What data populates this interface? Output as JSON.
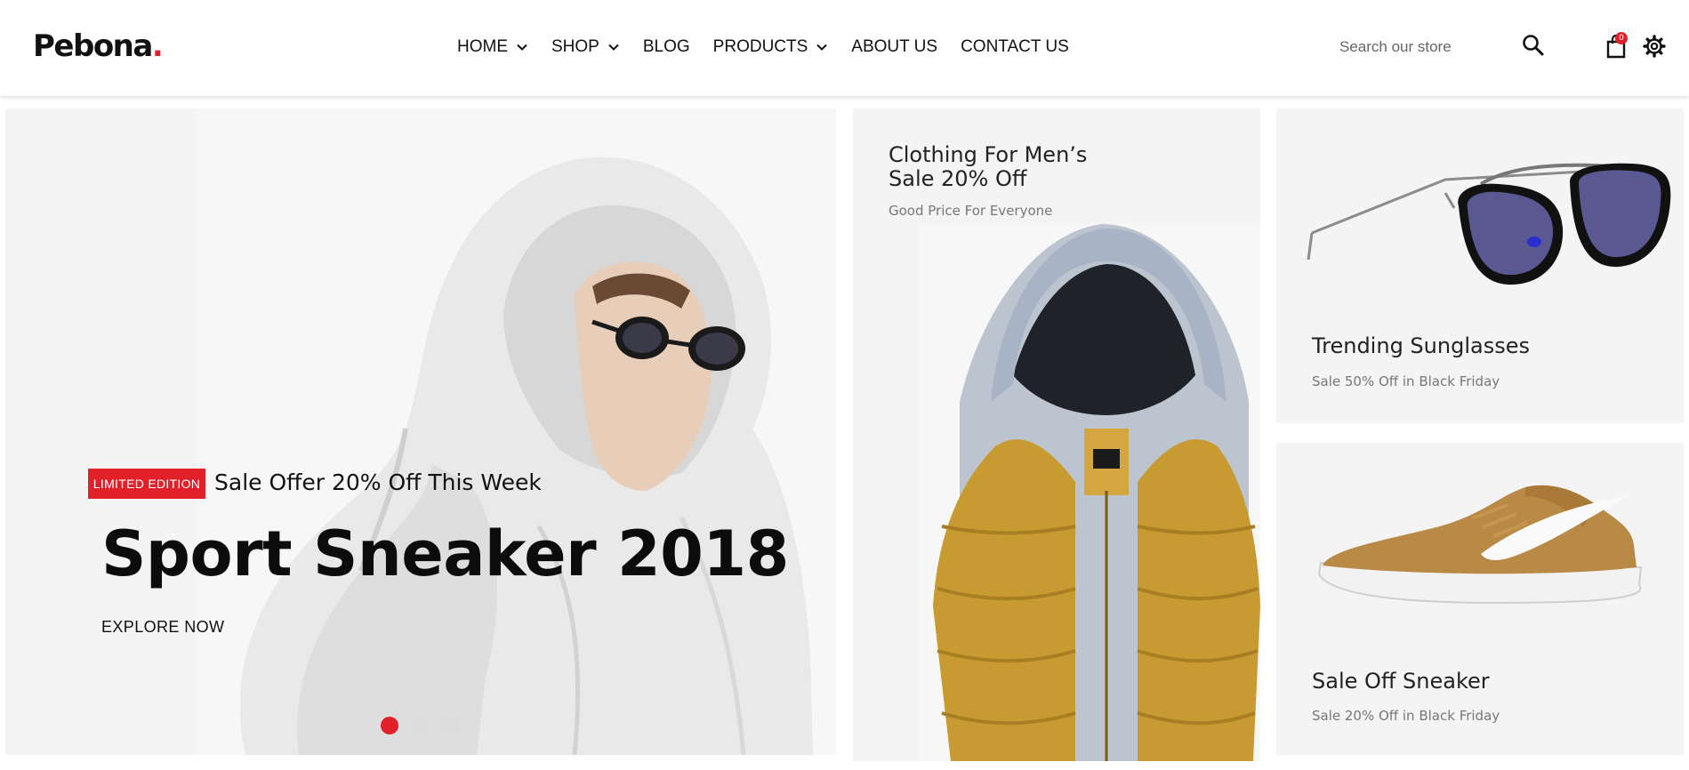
{
  "brand": {
    "name": "Pebona",
    "dot": ".",
    "accent": "#e1202a"
  },
  "nav": {
    "items": [
      {
        "label": "HOME",
        "has_dropdown": true
      },
      {
        "label": "SHOP",
        "has_dropdown": true
      },
      {
        "label": "BLOG",
        "has_dropdown": false
      },
      {
        "label": "PRODUCTS",
        "has_dropdown": true
      },
      {
        "label": "ABOUT US",
        "has_dropdown": false
      },
      {
        "label": "CONTACT US",
        "has_dropdown": false
      }
    ]
  },
  "header": {
    "search_placeholder": "Search our store",
    "search_icon": "search-icon",
    "cart_icon": "shopping-bag-icon",
    "cart_count": "0",
    "settings_icon": "gear-icon"
  },
  "hero": {
    "badge": "LIMITED EDITION",
    "offer": "Sale Offer 20% Off This Week",
    "title": "Sport Sneaker 2018",
    "cta": "EXPLORE NOW",
    "slides": {
      "count": 3,
      "active": 1
    }
  },
  "banners": {
    "clothing": {
      "title_line1": "Clothing For Men’s",
      "title_line2": "Sale 20% Off",
      "subtitle": "Good Price For Everyone"
    },
    "sunglasses": {
      "title": "Trending Sunglasses",
      "subtitle": "Sale 50% Off in Black Friday"
    },
    "sneaker": {
      "title": "Sale Off Sneaker",
      "subtitle": "Sale 20% Off in Black Friday"
    }
  }
}
